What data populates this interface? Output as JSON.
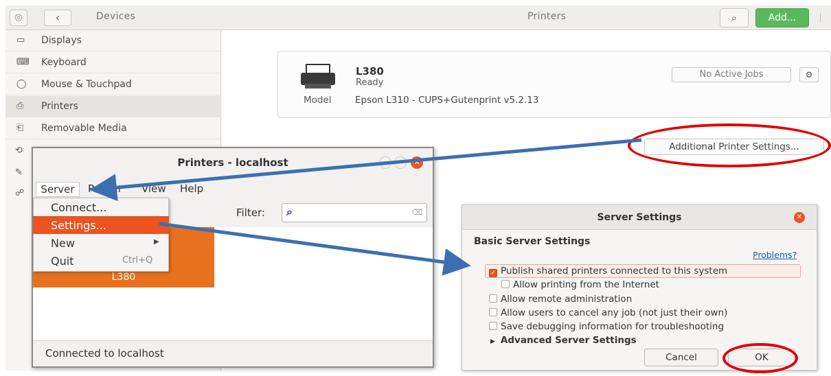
{
  "settings": {
    "header": {
      "panel_title": "Devices",
      "page_title": "Printers",
      "add_label": "Add..."
    },
    "sidebar_items": [
      {
        "label": "Displays",
        "icon": "display-icon"
      },
      {
        "label": "Keyboard",
        "icon": "keyboard-icon"
      },
      {
        "label": "Mouse & Touchpad",
        "icon": "mouse-icon"
      },
      {
        "label": "Printers",
        "icon": "printer-icon",
        "selected": true
      },
      {
        "label": "Removable Media",
        "icon": "removable-media-icon"
      }
    ],
    "printer": {
      "name": "L380",
      "status": "Ready",
      "jobs_label": "No Active Jobs",
      "model_label": "Model",
      "model_value": "Epson L310 - CUPS+Gutenprint v5.2.13"
    },
    "additional_settings_label": "Additional Printer Settings..."
  },
  "cups": {
    "title": "Printers - localhost",
    "menus": [
      "Server",
      "Printer",
      "View",
      "Help"
    ],
    "server_menu": [
      {
        "label": "Connect..."
      },
      {
        "label": "Settings...",
        "highlighted": true
      },
      {
        "label": "New",
        "submenu": true
      },
      {
        "label": "Quit",
        "shortcut": "Ctrl+Q"
      }
    ],
    "filter_label": "Filter:",
    "printer_tile": "L380",
    "status": "Connected to localhost"
  },
  "dialog": {
    "title": "Server Settings",
    "section": "Basic Server Settings",
    "problems_link": "Problems?",
    "options": [
      {
        "label": "Publish shared printers connected to this system",
        "checked": true
      },
      {
        "label": "Allow printing from the Internet",
        "checked": false
      },
      {
        "label": "Allow remote administration",
        "checked": false
      },
      {
        "label": "Allow users to cancel any job (not just their own)",
        "checked": false
      },
      {
        "label": "Save debugging information for troubleshooting",
        "checked": false
      }
    ],
    "advanced_label": "Advanced Server Settings",
    "cancel_label": "Cancel",
    "ok_label": "OK"
  },
  "colors": {
    "accent": "#e95420",
    "add_button": "#5cb85c",
    "annotation_red": "#e00000",
    "annotation_arrow": "#3d6fb0"
  }
}
